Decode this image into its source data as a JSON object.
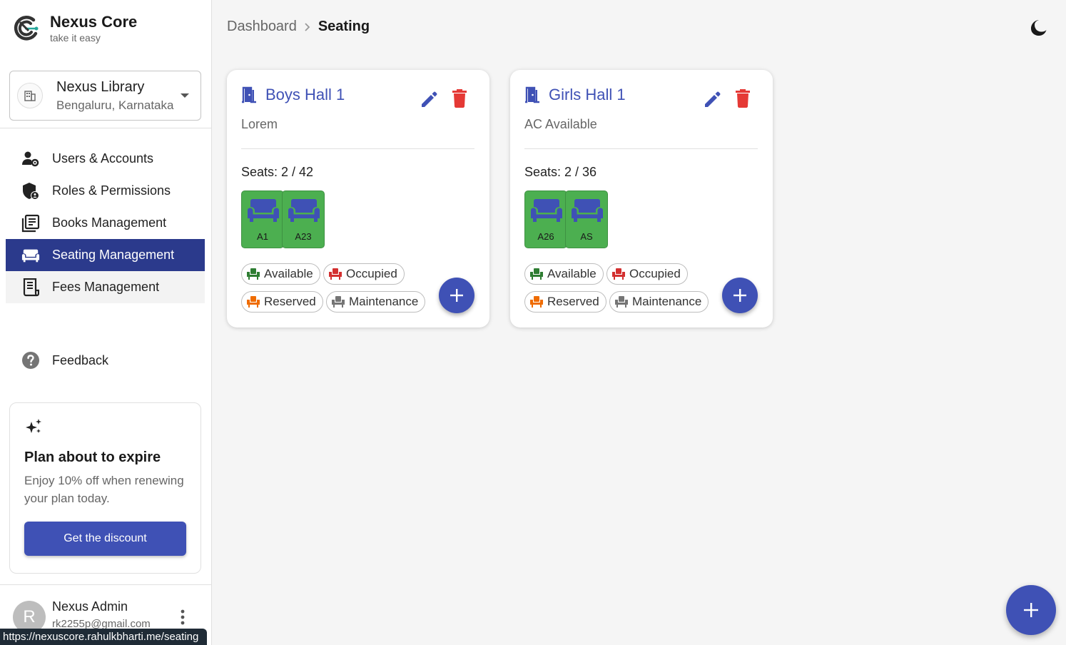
{
  "brand": {
    "name": "Nexus Core",
    "tagline": "take it easy"
  },
  "org": {
    "name": "Nexus Library",
    "location": "Bengaluru, Karnataka"
  },
  "nav": [
    {
      "label": "Users & Accounts",
      "icon": "user-gear-icon"
    },
    {
      "label": "Roles & Permissions",
      "icon": "shield-user-icon"
    },
    {
      "label": "Books Management",
      "icon": "books-icon"
    },
    {
      "label": "Seating Management",
      "icon": "sofa-icon",
      "active": true
    },
    {
      "label": "Fees Management",
      "icon": "receipt-icon"
    }
  ],
  "feedback": {
    "label": "Feedback",
    "icon": "help-circle-icon"
  },
  "promo": {
    "title": "Plan about to expire",
    "description": "Enjoy 10% off when renewing your plan today.",
    "button": "Get the discount",
    "icon": "sparkle-icon"
  },
  "user": {
    "initial": "R",
    "name": "Nexus Admin",
    "email": "rk2255p@gmail.com"
  },
  "status_url": "https://nexuscore.rahulkbharti.me/seating",
  "breadcrumb": {
    "parent": "Dashboard",
    "current": "Seating"
  },
  "halls": [
    {
      "name": "Boys Hall 1",
      "description": "Lorem",
      "seats_text": "Seats: 2 / 42",
      "seats": [
        {
          "label": "A1"
        },
        {
          "label": "A23"
        }
      ]
    },
    {
      "name": "Girls Hall 1",
      "description": "AC Available",
      "seats_text": "Seats: 2 / 36",
      "seats": [
        {
          "label": "A26"
        },
        {
          "label": "AS"
        }
      ]
    }
  ],
  "legend": {
    "available": "Available",
    "occupied": "Occupied",
    "reserved": "Reserved",
    "maintenance": "Maintenance"
  },
  "colors": {
    "primary": "#3f51b5",
    "nav_active": "#2b3a8c",
    "available": "#2e7d32",
    "seat_available_bg": "#4caf50",
    "occupied": "#d32f2f",
    "reserved": "#ef6c00",
    "maintenance": "#757575",
    "delete": "#e53935"
  }
}
